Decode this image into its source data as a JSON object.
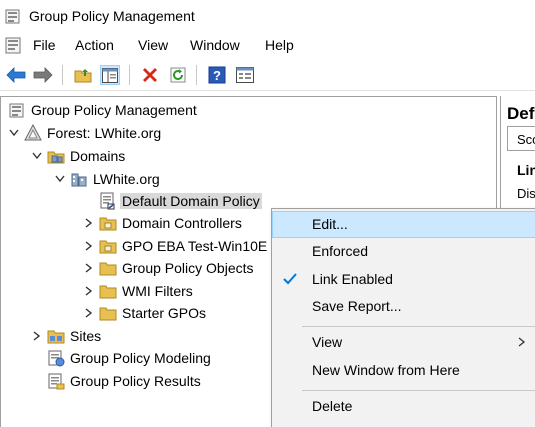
{
  "window": {
    "title": "Group Policy Management"
  },
  "menubar": {
    "items": [
      "File",
      "Action",
      "View",
      "Window",
      "Help"
    ]
  },
  "toolbar": {
    "buttons": [
      "back-icon",
      "forward-icon",
      "up-folder-icon",
      "show-hide-tree-icon",
      "delete-icon",
      "refresh-icon",
      "help-icon",
      "properties-icon"
    ]
  },
  "tree": {
    "root": "Group Policy Management",
    "forest": "Forest: LWhite.org",
    "domains": "Domains",
    "domain": "LWhite.org",
    "default_policy": "Default Domain Policy",
    "domain_controllers": "Domain Controllers",
    "gpo_eba": "GPO EBA Test-Win10E",
    "gpo_objects": "Group Policy Objects",
    "wmi": "WMI Filters",
    "starter": "Starter GPOs",
    "sites": "Sites",
    "modeling": "Group Policy Modeling",
    "results": "Group Policy Results"
  },
  "right_pane": {
    "title": "Def",
    "tab": "Sco",
    "link_heading": "Lin",
    "display": "Dis"
  },
  "context_menu": {
    "edit": "Edit...",
    "enforced": "Enforced",
    "link_enabled": "Link Enabled",
    "link_enabled_checked": true,
    "save_report": "Save Report...",
    "view": "View",
    "new_window": "New Window from Here",
    "delete": "Delete"
  },
  "colors": {
    "selection": "#cce8ff",
    "selection_border": "#99d1ff",
    "menu_bg": "#f2f2f2",
    "check": "#0078d7",
    "folder": "#e8c052"
  }
}
